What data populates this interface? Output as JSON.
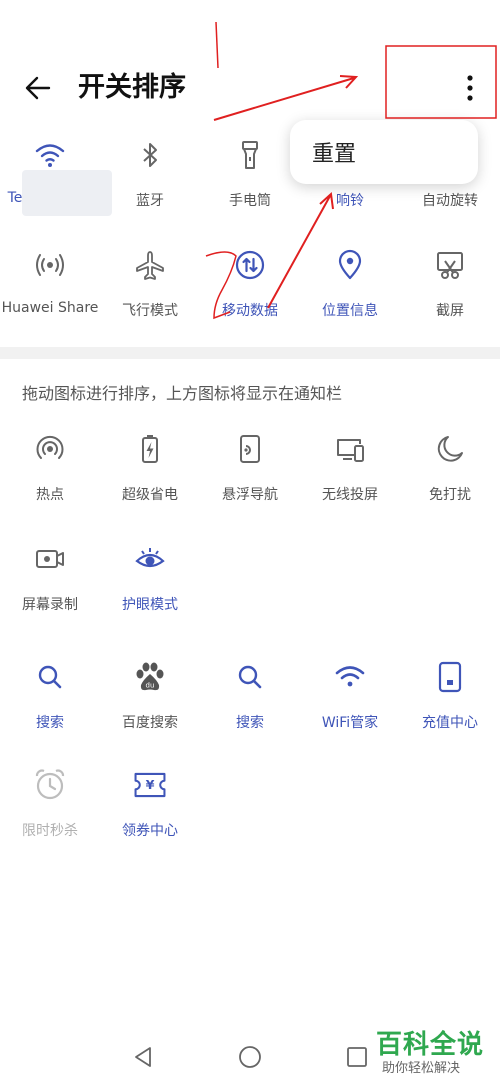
{
  "header": {
    "title": "开关排序",
    "back_icon": "back-arrow-icon",
    "more_icon": "more-vertical-icon"
  },
  "popup_menu": {
    "items": [
      {
        "label": "重置"
      }
    ]
  },
  "top_section": {
    "items": [
      {
        "label": "Te",
        "icon": "wifi-icon",
        "active": true
      },
      {
        "label": "蓝牙",
        "icon": "bluetooth-icon",
        "active": false
      },
      {
        "label": "手电筒",
        "icon": "flashlight-icon",
        "active": false
      },
      {
        "label": "响铃",
        "icon": "bell-icon",
        "active": true
      },
      {
        "label": "自动旋转",
        "icon": "auto-rotate-icon",
        "active": false
      },
      {
        "label": "Huawei Share",
        "icon": "huawei-share-icon",
        "active": false
      },
      {
        "label": "飞行模式",
        "icon": "airplane-icon",
        "active": false
      },
      {
        "label": "移动数据",
        "icon": "mobile-data-icon",
        "active": true
      },
      {
        "label": "位置信息",
        "icon": "location-icon",
        "active": true
      },
      {
        "label": "截屏",
        "icon": "screenshot-icon",
        "active": false
      }
    ]
  },
  "hint": "拖动图标进行排序，上方图标将显示在通知栏",
  "bottom_section": {
    "items": [
      {
        "label": "热点",
        "icon": "hotspot-icon",
        "state": "normal"
      },
      {
        "label": "超级省电",
        "icon": "battery-saver-icon",
        "state": "normal"
      },
      {
        "label": "悬浮导航",
        "icon": "floating-nav-icon",
        "state": "normal"
      },
      {
        "label": "无线投屏",
        "icon": "wireless-projection-icon",
        "state": "normal"
      },
      {
        "label": "免打扰",
        "icon": "moon-icon",
        "state": "normal"
      },
      {
        "label": "屏幕录制",
        "icon": "screen-record-icon",
        "state": "normal"
      },
      {
        "label": "护眼模式",
        "icon": "eye-icon",
        "state": "blue"
      }
    ]
  },
  "app_section": {
    "items": [
      {
        "label": "搜索",
        "icon": "search-icon",
        "state": "blue"
      },
      {
        "label": "百度搜索",
        "icon": "baidu-paw-icon",
        "state": "normal"
      },
      {
        "label": "搜索",
        "icon": "search-icon",
        "state": "blue"
      },
      {
        "label": "WiFi管家",
        "icon": "wifi-icon",
        "state": "blue"
      },
      {
        "label": "充值中心",
        "icon": "phone-card-icon",
        "state": "blue"
      },
      {
        "label": "限时秒杀",
        "icon": "alarm-clock-icon",
        "state": "dim"
      },
      {
        "label": "领券中心",
        "icon": "coupon-yen-icon",
        "state": "blue"
      }
    ]
  },
  "watermark": {
    "main": "百科全说",
    "sub": "助你轻松解决"
  },
  "colors": {
    "accent": "#3f55b8",
    "icon_gray": "#666666",
    "annotation_red": "#e02020"
  }
}
